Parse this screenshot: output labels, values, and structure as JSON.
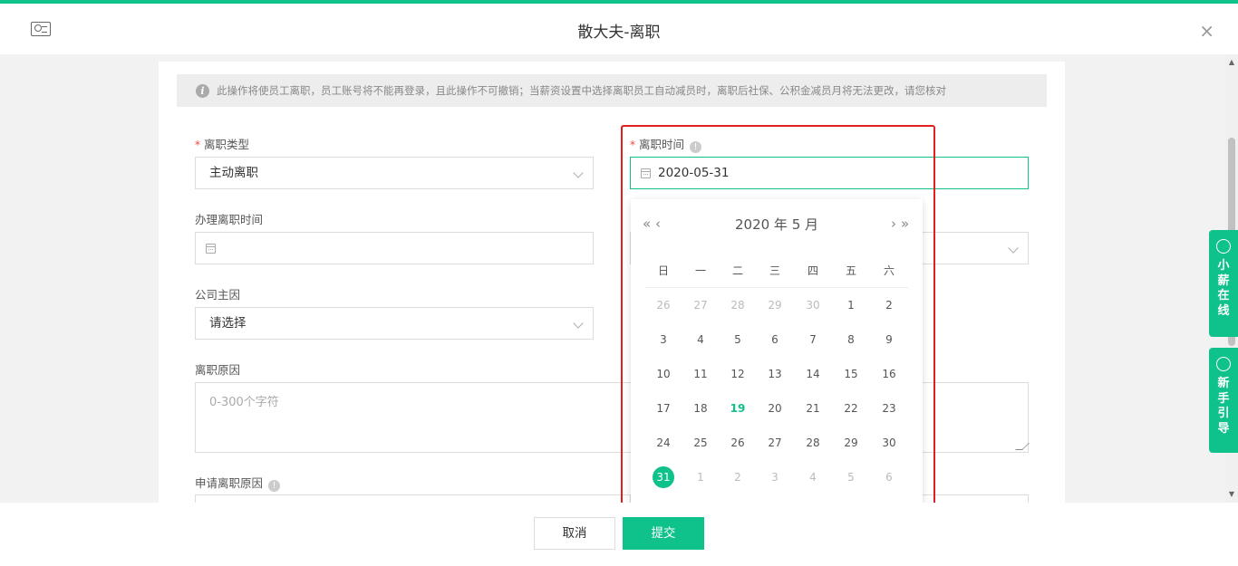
{
  "header": {
    "title": "散大夫-离职",
    "close": "×"
  },
  "notice": {
    "text": "此操作将使员工离职，员工账号将不能再登录，且此操作不可撤销；当薪资设置中选择离职员工自动减员时，离职后社保、公积金减员月将无法更改，请您核对",
    "icon": "i"
  },
  "form": {
    "leave_type": {
      "label": "离职类型",
      "value": "主动离职"
    },
    "leave_date": {
      "label": "离职时间",
      "value": "2020-05-31"
    },
    "handle_date": {
      "label": "办理离职时间",
      "value": ""
    },
    "company_reason": {
      "label": "公司主因",
      "value": "请选择"
    },
    "leave_reason": {
      "label": "离职原因",
      "placeholder": "0-300个字符"
    },
    "apply_reason": {
      "label": "申请离职原因"
    }
  },
  "calendar": {
    "prev_year": "«",
    "prev_month": "‹",
    "next_month": "›",
    "next_year": "»",
    "title": "2020 年  5 月",
    "weekdays": [
      "日",
      "一",
      "二",
      "三",
      "四",
      "五",
      "六"
    ],
    "rows": [
      [
        "26",
        "27",
        "28",
        "29",
        "30",
        "1",
        "2"
      ],
      [
        "3",
        "4",
        "5",
        "6",
        "7",
        "8",
        "9"
      ],
      [
        "10",
        "11",
        "12",
        "13",
        "14",
        "15",
        "16"
      ],
      [
        "17",
        "18",
        "19",
        "20",
        "21",
        "22",
        "23"
      ],
      [
        "24",
        "25",
        "26",
        "27",
        "28",
        "29",
        "30"
      ],
      [
        "31",
        "1",
        "2",
        "3",
        "4",
        "5",
        "6"
      ]
    ],
    "today": "19",
    "selected": "31"
  },
  "footer": {
    "cancel": "取消",
    "submit": "提交"
  },
  "side": {
    "online": "小薪在线",
    "guide": "新手引导"
  },
  "colors": {
    "accent": "#0fc18a",
    "highlight": "#e02020"
  }
}
